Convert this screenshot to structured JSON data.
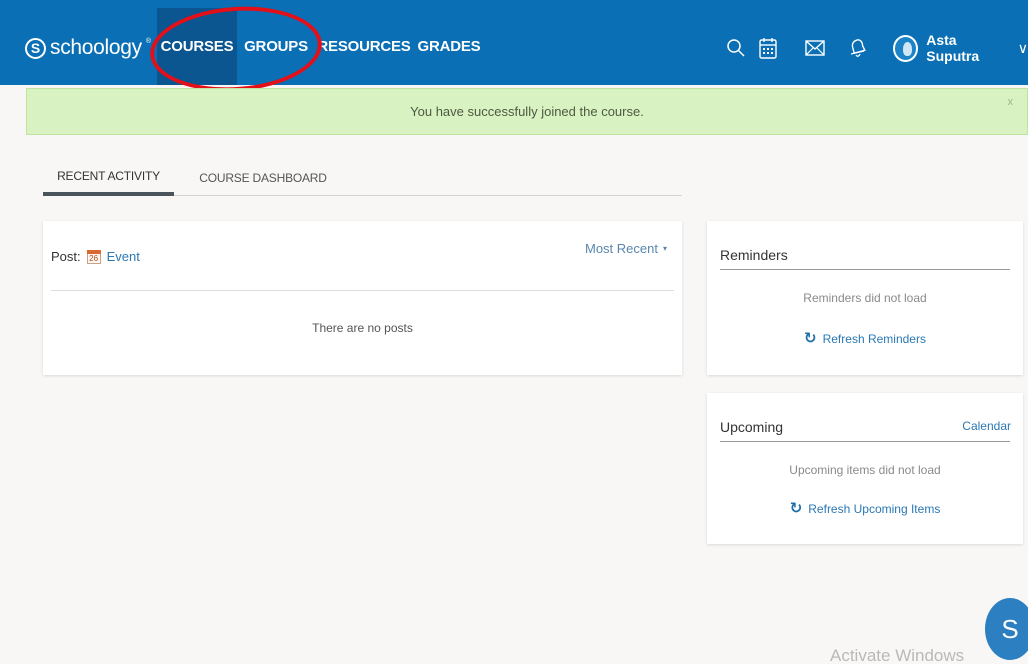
{
  "brand": {
    "name": "schoology",
    "mark": "S",
    "trademark": "®"
  },
  "nav": {
    "courses": "COURSES",
    "groups": "GROUPS",
    "resources": "RESOURCES",
    "grades": "GRADES"
  },
  "header_icons": [
    "search-icon",
    "calendar-icon",
    "mail-icon",
    "bell-icon"
  ],
  "user": {
    "name": "Asta Suputra",
    "chevron": "∨"
  },
  "banner": {
    "message": "You have successfully joined the course.",
    "close": "x"
  },
  "tabs": {
    "recent_activity": "RECENT ACTIVITY",
    "course_dashboard": "COURSE DASHBOARD"
  },
  "activity": {
    "post_label": "Post:",
    "event_day": "26",
    "event_link": "Event",
    "sort_label": "Most Recent",
    "sort_caret": "▾",
    "empty_message": "There are no posts"
  },
  "reminders": {
    "title": "Reminders",
    "message": "Reminders did not load",
    "refresh": "Refresh Reminders"
  },
  "upcoming": {
    "title": "Upcoming",
    "calendar_link": "Calendar",
    "message": "Upcoming items did not load",
    "refresh": "Refresh Upcoming Items"
  },
  "overlays": {
    "watermark": "Activate Windows",
    "fab": "S"
  },
  "colors": {
    "nav_bg": "#0a6fb4",
    "nav_active": "#0b5590",
    "banner_bg": "#d9f2c2",
    "annotation": "#e3101a",
    "link": "#2b78b4"
  }
}
